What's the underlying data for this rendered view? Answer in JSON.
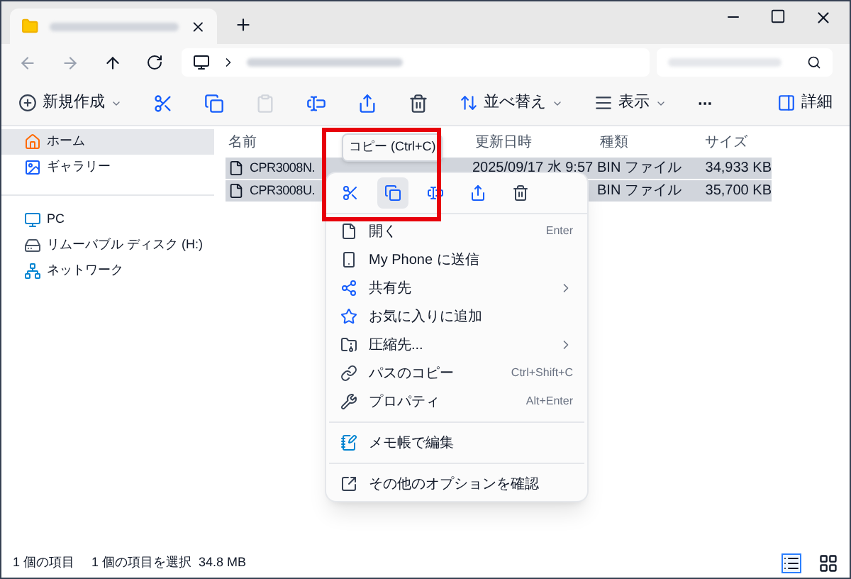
{
  "toolbar": {
    "items": [
      {
        "kind": "new",
        "label": "新規作成",
        "disabled": false
      },
      {
        "kind": "cut",
        "disabled": false
      },
      {
        "kind": "copy",
        "disabled": false
      },
      {
        "kind": "paste",
        "disabled": true
      },
      {
        "kind": "rename",
        "disabled": false
      },
      {
        "kind": "share",
        "disabled": false
      },
      {
        "kind": "delete",
        "disabled": false
      },
      {
        "kind": "sort",
        "label": "並べ替え",
        "disabled": false
      },
      {
        "kind": "view",
        "label": "表示",
        "disabled": false
      },
      {
        "kind": "more",
        "label": "···",
        "disabled": false
      }
    ],
    "details": "詳細"
  },
  "sidebar": {
    "groups": [
      [
        {
          "kind": "home",
          "label": "ホーム",
          "selected": true
        },
        {
          "kind": "gallery",
          "label": "ギャラリー",
          "selected": false
        }
      ],
      [
        {
          "kind": "pc",
          "label": "PC",
          "selected": false
        },
        {
          "kind": "drive",
          "label": "リムーバブル ディスク (H:)",
          "selected": false
        },
        {
          "kind": "network",
          "label": "ネットワーク",
          "selected": false
        }
      ]
    ]
  },
  "table": {
    "columns": [
      "名前",
      "更新日時",
      "種類",
      "サイズ"
    ],
    "rows": [
      {
        "name": "CPR3008N.",
        "modified": "2025/09/17 水 9:57",
        "type": "BIN ファイル",
        "size": "34,933 KB",
        "selected": true
      },
      {
        "name": "CPR3008U.",
        "type": "BIN ファイル",
        "size": "35,700 KB",
        "selected": true
      }
    ]
  },
  "tooltip": "コピー (Ctrl+C)",
  "context_menu": {
    "quick_actions": [
      {
        "kind": "cut",
        "selected": false
      },
      {
        "kind": "copy",
        "selected": true
      },
      {
        "kind": "rename",
        "selected": false
      },
      {
        "kind": "share",
        "selected": false
      },
      {
        "kind": "delete",
        "selected": false
      }
    ],
    "items": [
      {
        "kind": "open",
        "label": "開く",
        "shortcut": "Enter"
      },
      {
        "kind": "phone",
        "label": "My Phone に送信"
      },
      {
        "kind": "share",
        "label": "共有先",
        "submenu": true
      },
      {
        "kind": "star",
        "label": "お気に入りに追加"
      },
      {
        "kind": "zip",
        "label": "圧縮先...",
        "submenu": true
      },
      {
        "kind": "path",
        "label": "パスのコピー",
        "shortcut": "Ctrl+Shift+C"
      },
      {
        "kind": "props",
        "label": "プロパティ",
        "shortcut": "Alt+Enter"
      },
      {
        "kind": "separator"
      },
      {
        "kind": "notepad",
        "label": "メモ帳で編集"
      },
      {
        "kind": "separator"
      },
      {
        "kind": "options",
        "label": "その他のオプションを確認"
      }
    ]
  },
  "status_bar": {
    "count": "1 個の項目",
    "selection": "1 個の項目を選択  34.8 MB",
    "views": [
      {
        "kind": "details",
        "selected": true
      },
      {
        "kind": "tiles",
        "selected": false
      }
    ]
  }
}
